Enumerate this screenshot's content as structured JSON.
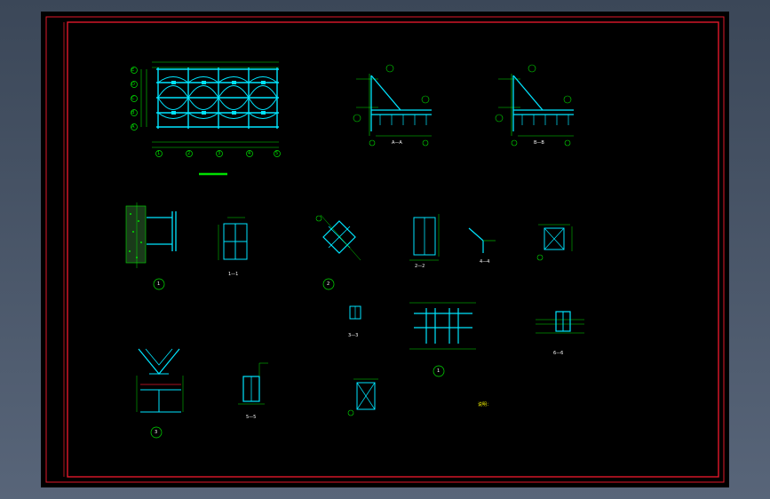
{
  "colors": {
    "background": "#000000",
    "frame": "#e0182a",
    "grid": "#00e5ff",
    "dims": "#00e000",
    "text": "#ffffff",
    "notes": "#f2f200",
    "member": "#ff3040"
  },
  "title_block": {
    "cells": [
      "",
      "",
      "",
      "",
      "",
      "",
      ""
    ]
  },
  "plan": {
    "grid_rows": [
      "E",
      "D",
      "C",
      "B",
      "A"
    ],
    "grid_cols": [
      "1",
      "2",
      "3",
      "4",
      "5"
    ],
    "caption": ""
  },
  "sections": {
    "a_a": "A—A",
    "b_b": "B—B",
    "s1": "1—1",
    "s2": "2—2",
    "s3": "3—3",
    "s4": "4—4",
    "s5": "5—5",
    "s6": "6—6"
  },
  "details": {
    "d1": "1",
    "d2": "2",
    "d3": "3",
    "d4": "1"
  },
  "notes": {
    "heading": "说明：",
    "items": [
      "",
      "",
      "",
      ""
    ]
  }
}
